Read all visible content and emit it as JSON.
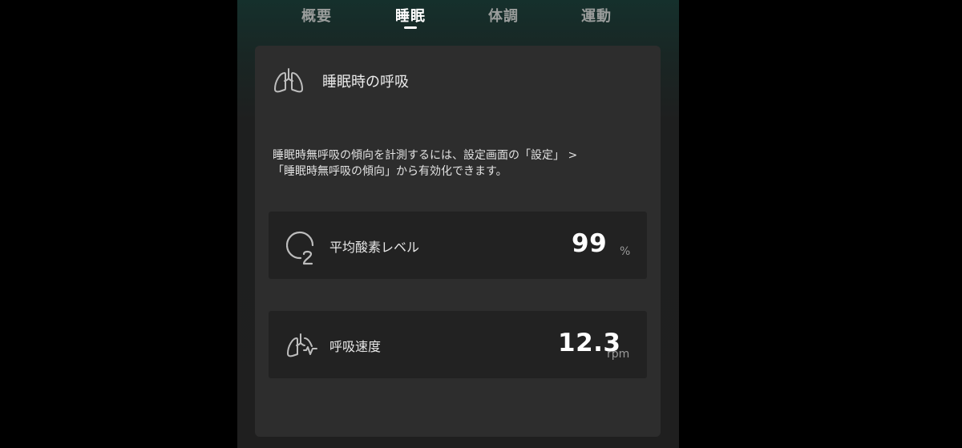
{
  "tabs": [
    {
      "label": "概要"
    },
    {
      "label": "睡眠"
    },
    {
      "label": "体調"
    },
    {
      "label": "運動"
    }
  ],
  "active_tab": "睡眠",
  "card": {
    "title": "睡眠時の呼吸",
    "icon": "lungs-icon",
    "notice_line1": "睡眠時無呼吸の傾向を計測するには、設定画面の「設定」 >",
    "notice_line2": "「睡眠時無呼吸の傾向」から有効化できます。"
  },
  "metrics": [
    {
      "label": "平均酸素レベル",
      "value": "99",
      "unit": "%",
      "icon": "oxygen-o2-icon"
    },
    {
      "label": "呼吸速度",
      "value": "12.3",
      "unit": "rpm",
      "icon": "lungs-breathing-icon"
    }
  ],
  "colors": {
    "background": "#000000",
    "card": "#2d2d2d",
    "metric_row": "#222222",
    "text_primary": "#ffffff",
    "tab_inactive": "#9a9d9c"
  }
}
